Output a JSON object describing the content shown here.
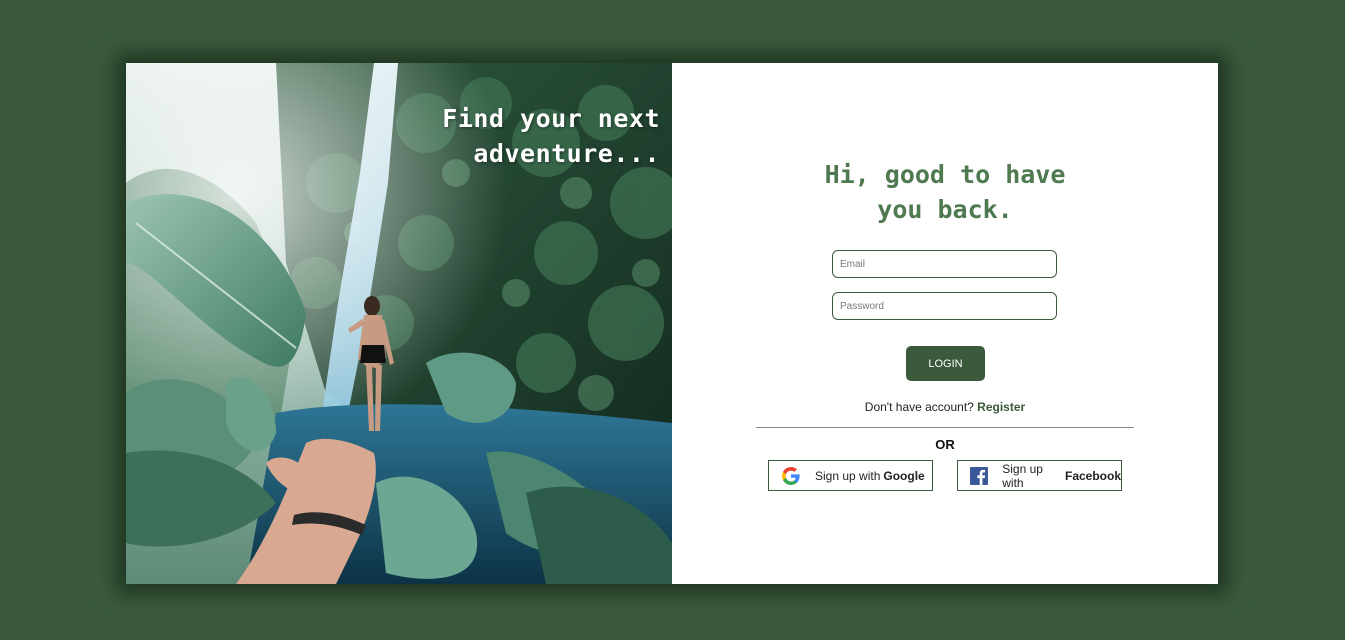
{
  "hero": {
    "tagline_line1": "Find your next",
    "tagline_line2": "adventure..."
  },
  "form": {
    "greeting_line1": "Hi, good to have",
    "greeting_line2": "you back.",
    "email_placeholder": "Email",
    "password_placeholder": "Password",
    "login_label": "LOGIN",
    "register_prompt": "Don't have account?",
    "register_link": "Register",
    "or_label": "OR",
    "google_prefix": "Sign up with",
    "google_brand": "Google",
    "facebook_prefix": "Sign up with",
    "facebook_brand": "Facebook"
  },
  "colors": {
    "background": "#3b5a3c",
    "accent": "#3a5a3b",
    "greeting": "#4f7a50"
  },
  "icons": {
    "google": "google-icon",
    "facebook": "facebook-icon"
  }
}
